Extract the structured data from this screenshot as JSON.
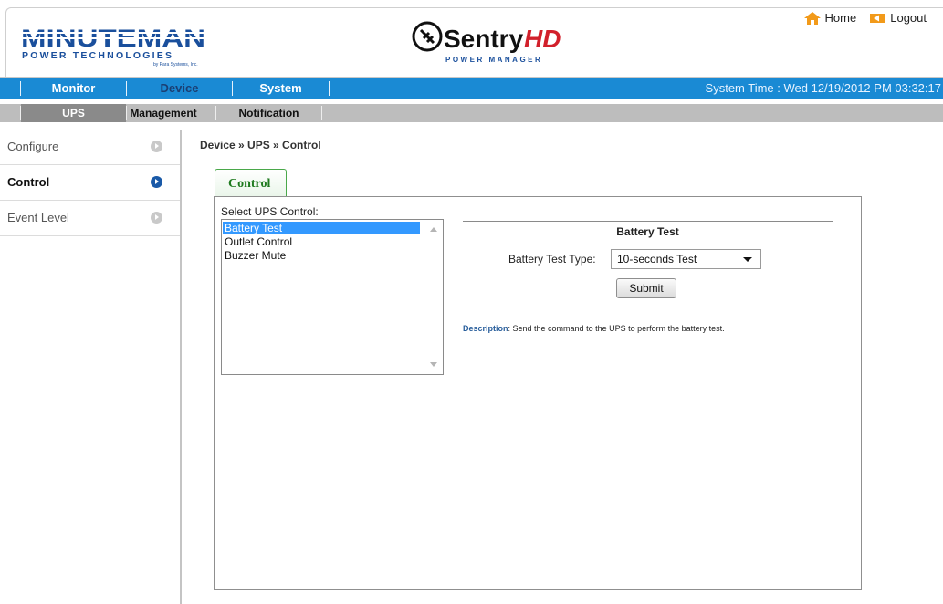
{
  "header": {
    "brand_left": {
      "name": "MINUTEMAN",
      "tagline": "POWER TECHNOLOGIES",
      "subtag": "by Para Systems, Inc."
    },
    "brand_right": {
      "name": "SentryHD",
      "tagline": "POWER MANAGER"
    },
    "links": {
      "home": "Home",
      "logout": "Logout"
    }
  },
  "main_nav": {
    "tabs": [
      "Monitor",
      "Device",
      "System"
    ],
    "active_tab": "Device",
    "system_time": "System Time : Wed 12/19/2012 PM 03:32:17"
  },
  "sub_nav": {
    "tabs": [
      "UPS",
      "Management",
      "Notification"
    ],
    "active_tab": "UPS"
  },
  "sidebar": {
    "items": [
      "Configure",
      "Control",
      "Event Level"
    ],
    "active_item": "Control"
  },
  "content": {
    "breadcrumb": "Device » UPS » Control",
    "tab_label": "Control",
    "select_label": "Select UPS Control:",
    "control_options": [
      "Battery Test",
      "Outlet Control",
      "Buzzer Mute"
    ],
    "selected_option": "Battery Test",
    "form": {
      "title": "Battery Test",
      "field_label": "Battery Test Type:",
      "field_value": "10-seconds Test",
      "submit_label": "Submit"
    },
    "description": {
      "label": "Description",
      "text": ": Send the command to the UPS to perform the battery test."
    }
  },
  "colors": {
    "nav_blue": "#1a8ad4",
    "active_nav_text": "#1b3f73",
    "subnav_gray": "#bdbdbd",
    "active_subtab": "#8a8a8a",
    "tab_green": "#1f7a1f",
    "selection_blue": "#3399ff",
    "brand_blue": "#1a4f9c",
    "brand_red": "#d2202b"
  },
  "icons": {
    "home": "home-icon",
    "logout": "logout-icon",
    "sidebar_arrow": "circle-arrow-icon",
    "dropdown": "chevron-down-icon"
  }
}
